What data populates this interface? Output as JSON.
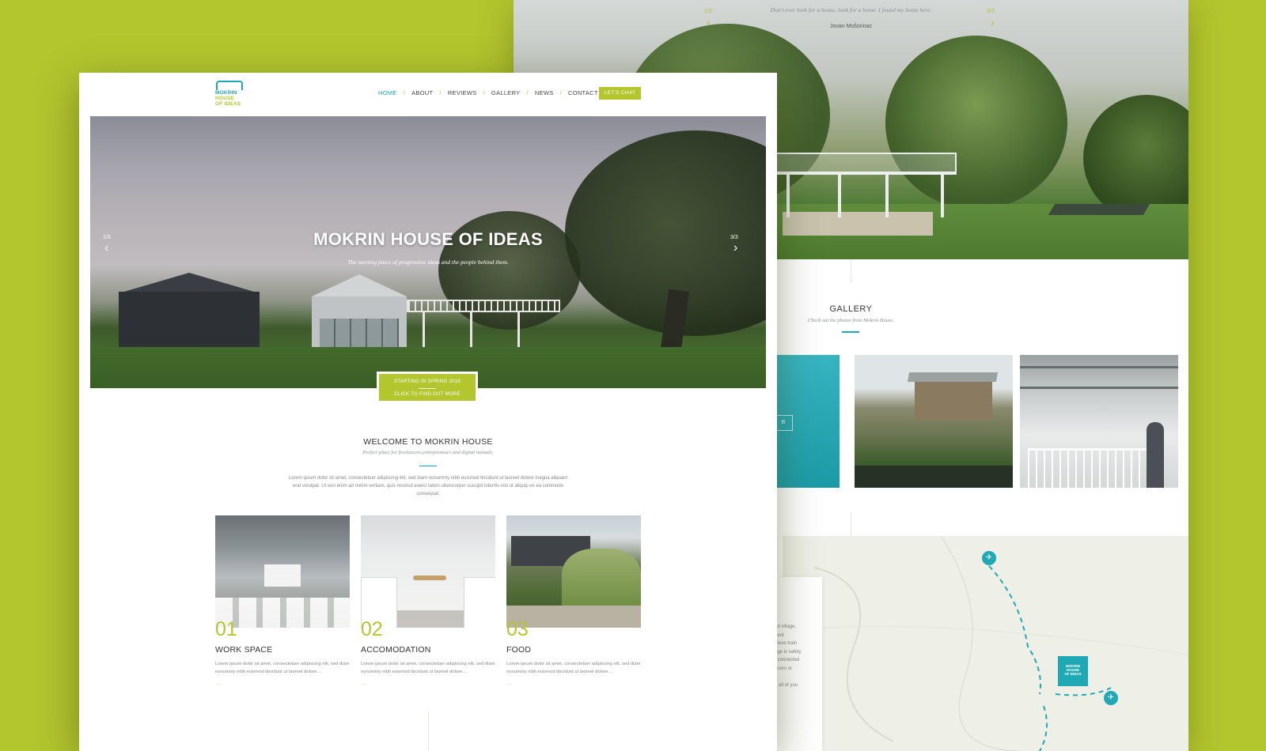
{
  "colors": {
    "background": "#b3c62e",
    "accent_green": "#b3c62e",
    "accent_teal": "#1fa9b4"
  },
  "back_page": {
    "slider": {
      "quote": "Don't ever look for a house, look for a home. I found my home here.",
      "author": "Jovan Mošorinac",
      "counter_left": "1/3",
      "counter_right": "3/3",
      "prev_icon": "chevron-left-icon",
      "next_icon": "chevron-right-icon"
    },
    "gallery": {
      "title": "GALLERY",
      "subtitle": "Check out the photos from Mokrin House."
    },
    "map": {
      "text_lines": [
        "ed village.",
        "rient",
        "mous train",
        "age is safely",
        "r connected",
        "hours or",
        "",
        "e all of you"
      ],
      "marker_lines": [
        "MOKRIN",
        "HOUSE",
        "OF IDEAS"
      ],
      "pin_icon": "airplane-icon"
    }
  },
  "front_page": {
    "logo": {
      "line1": "MOKRIN",
      "line2": "HOUSE",
      "line3": "OF IDEAS"
    },
    "nav": {
      "items": [
        "HOME",
        "ABOUT",
        "REVIEWS",
        "GALLERY",
        "NEWS",
        "CONTACT"
      ],
      "active": "HOME",
      "separator": "/",
      "cta": "LET'S CHAT"
    },
    "hero": {
      "title": "MOKRIN HOUSE OF IDEAS",
      "subtitle": "The meeting place of progressive ideas and the people behind them.",
      "counter_left": "1/3",
      "counter_right": "3/3",
      "prev_icon": "chevron-left-icon",
      "next_icon": "chevron-right-icon"
    },
    "cta": {
      "line1": "STARTING IN SPRING 2016",
      "line2": "CLICK TO FIND OUT MORE"
    },
    "welcome": {
      "title": "WELCOME TO MOKRIN HOUSE",
      "subtitle": "Perfect place for freelancers,entrepreneurs and digital nomads.",
      "body": "Lorem ipsum dolor sit amet, consectetuer adipiscing elit, sed diam nonummy nibh euismod tincidunt ut laoreet dolore magna aliquam erat volutpat. Ut wisi enim ad minim veniam, quis nostrud exerci tation ullamcorper suscipit lobortis nisl ut aliquip ex ea commodo consequat."
    },
    "features": [
      {
        "number": "01",
        "title": "WORK SPACE",
        "body": "Lorem ipsum dolor sit amet, consectetuer adipiscing elit, sed diam nonummy nibh euismod tincidunt ut laoreet dolore...",
        "more": "..."
      },
      {
        "number": "02",
        "title": "ACCOMODATION",
        "body": "Lorem ipsum dolor sit amet, consectetuer adipiscing elit, sed diam nonummy nibh euismod tincidunt ut laoreet dolore...",
        "more": "..."
      },
      {
        "number": "03",
        "title": "FOOD",
        "body": "Lorem ipsum dolor sit amet, consectetuer adipiscing elit, sed diam nonummy nibh euismod tincidunt ut laoreet dolore...",
        "more": "..."
      }
    ]
  }
}
